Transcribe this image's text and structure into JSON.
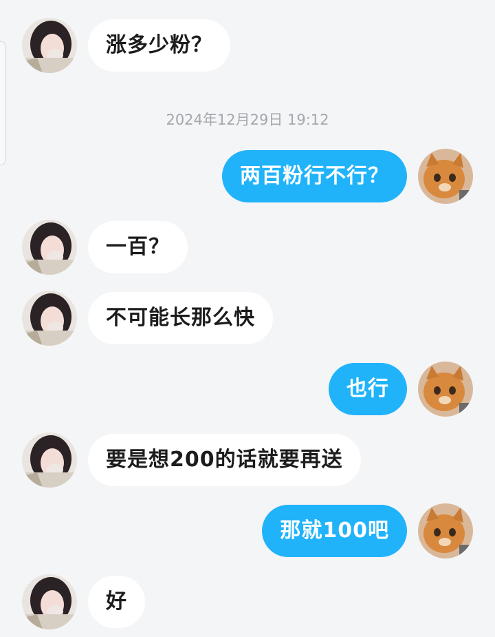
{
  "chat": {
    "timestamp": "2024年12月29日 19:12",
    "messages": [
      {
        "side": "in",
        "text": "涨多少粉？",
        "avatar": "girl-avatar"
      },
      {
        "side": "out",
        "text": "两百粉行不行？",
        "avatar": "cat-avatar"
      },
      {
        "side": "in",
        "text": "一百？",
        "avatar": "girl-avatar"
      },
      {
        "side": "in",
        "text": "不可能长那么快",
        "avatar": "girl-avatar"
      },
      {
        "side": "out",
        "text": "也行",
        "avatar": "cat-avatar"
      },
      {
        "side": "in",
        "text": "要是想200的话就要再送",
        "avatar": "girl-avatar"
      },
      {
        "side": "out",
        "text": "那就100吧",
        "avatar": "cat-avatar"
      },
      {
        "side": "in",
        "text": "好",
        "avatar": "girl-avatar"
      }
    ]
  },
  "colors": {
    "background": "#f4f5f7",
    "incoming_bubble": "#ffffff",
    "outgoing_bubble": "#20b3fa",
    "timestamp_text": "#a4a7ad"
  }
}
